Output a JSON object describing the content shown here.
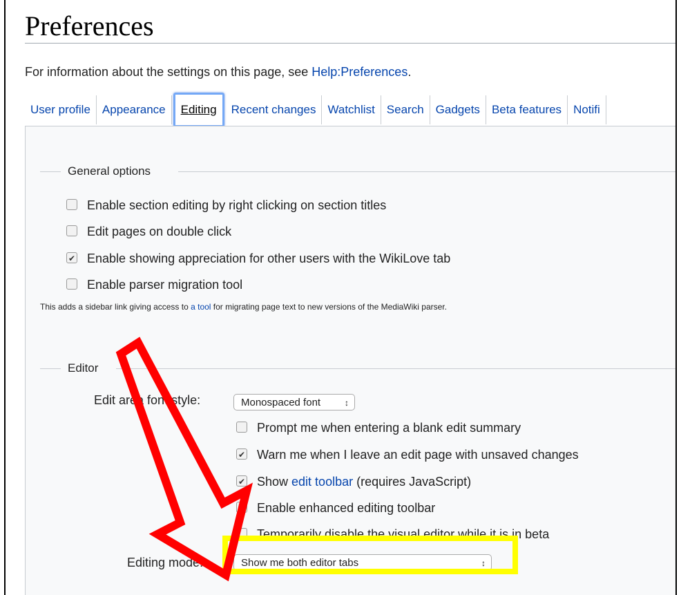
{
  "page": {
    "title": "Preferences"
  },
  "intro": {
    "text": "For information about the settings on this page, see ",
    "link": "Help:Preferences",
    "end": "."
  },
  "tabs": [
    {
      "label": "User profile"
    },
    {
      "label": "Appearance"
    },
    {
      "label": "Editing"
    },
    {
      "label": "Recent changes"
    },
    {
      "label": "Watchlist"
    },
    {
      "label": "Search"
    },
    {
      "label": "Gadgets"
    },
    {
      "label": "Beta features"
    },
    {
      "label": "Notifi"
    }
  ],
  "general": {
    "legend": "General options",
    "options": [
      {
        "label": "Enable section editing by right clicking on section titles",
        "checked": false
      },
      {
        "label": "Edit pages on double click",
        "checked": false
      },
      {
        "label": "Enable showing appreciation for other users with the WikiLove tab",
        "checked": true
      },
      {
        "label": "Enable parser migration tool",
        "checked": false
      }
    ],
    "help_pre": "This adds a sidebar link giving access to ",
    "help_link": "a tool",
    "help_post": " for migrating page text to new versions of the MediaWiki parser."
  },
  "editor": {
    "legend": "Editor",
    "font_label": "Edit area font style:",
    "font_value": "Monospaced font",
    "options": [
      {
        "label": "Prompt me when entering a blank edit summary",
        "checked": false
      },
      {
        "label": "Warn me when I leave an edit page with unsaved changes",
        "checked": true
      },
      {
        "pre": "Show ",
        "link": "edit toolbar",
        "post": " (requires JavaScript)",
        "checked": true
      },
      {
        "label": "Enable enhanced editing toolbar",
        "checked": true
      },
      {
        "label": "Temporarily disable the visual editor while it is in beta",
        "checked": false
      }
    ],
    "mode_label": "Editing mode:",
    "mode_value": "Show me both editor tabs"
  },
  "colors": {
    "highlight": "#ffff00",
    "arrow": "#ff0000",
    "link": "#0645ad",
    "active_tab_border": "#74a8f6"
  },
  "icons": {
    "select_arrows": "updown-arrows-icon",
    "checkmark": "checkmark-icon"
  }
}
